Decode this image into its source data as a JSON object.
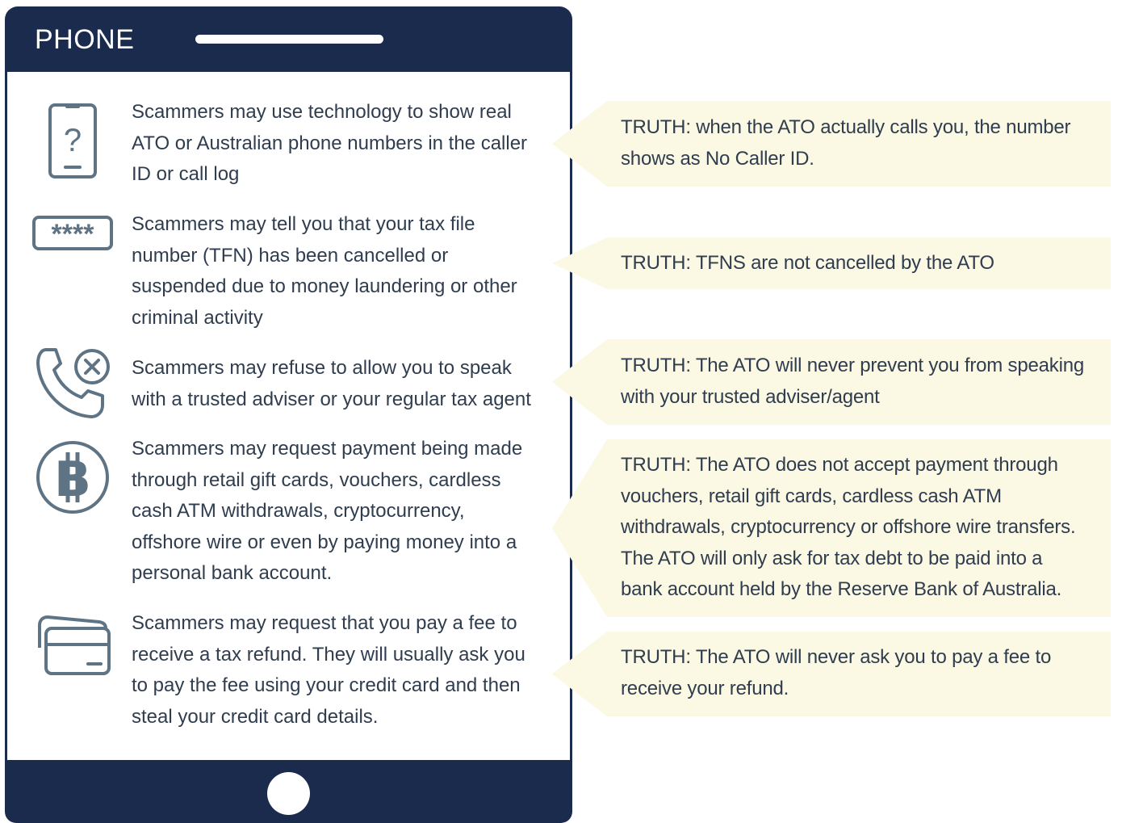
{
  "phone": {
    "title": "PHONE"
  },
  "rows": [
    {
      "icon": "smartphone-question-icon",
      "claim": "Scammers may use technology to show real ATO or Australian phone numbers in the caller ID or call log",
      "truth": "TRUTH: when the ATO actually calls you, the number shows as No Caller ID."
    },
    {
      "icon": "password-field-icon",
      "claim": "Scammers may tell you that your tax file number (TFN) has been cancelled or suspended due to money laundering or other criminal activity",
      "truth": "TRUTH: TFNS are not cancelled by the ATO"
    },
    {
      "icon": "phone-cancel-icon",
      "claim": "Scammers may refuse to allow you to speak with a trusted adviser or your regular tax agent",
      "truth": "TRUTH: The ATO will never prevent you from speaking with your trusted adviser/agent"
    },
    {
      "icon": "bitcoin-icon",
      "claim": "Scammers may request payment being made through retail gift cards, vouchers, cardless cash ATM withdrawals, cryptocurrency, offshore wire or even by paying money into a personal bank account.",
      "truth": "TRUTH: The ATO does not accept payment through vouchers, retail gift cards, cardless cash ATM withdrawals, cryptocurrency or offshore wire transfers. The ATO will only ask for tax debt to be paid into a bank account held by the Reserve Bank of Australia."
    },
    {
      "icon": "credit-cards-icon",
      "claim": "Scammers may request that you pay a fee to receive a tax refund. They will usually ask you to pay the fee using your credit card and then steal your credit card details.",
      "truth": "TRUTH: The ATO will never ask you to pay a fee to receive your refund."
    }
  ],
  "colors": {
    "phone_frame": "#1a2b4e",
    "icon": "#5e7384",
    "text": "#2f3d4f",
    "truth_background": "#fbf8e3"
  }
}
